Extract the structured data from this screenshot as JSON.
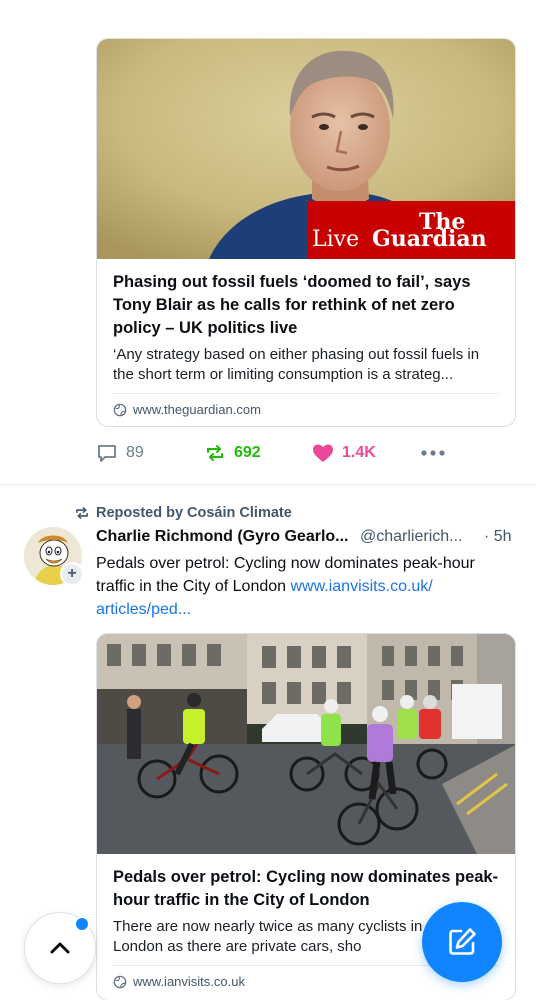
{
  "post1": {
    "card": {
      "image_badge_line1": "The",
      "image_badge_line2": "Live",
      "image_badge_line3": "Guardian",
      "title": "Phasing out fossil fuels ‘doomed to fail’, says Tony Blair as he calls for rethink of net zero policy – UK politics live",
      "description": "‘Any strategy based on either phasing out fossil fuels in the short term or limiting consumption is a strateg...",
      "domain": "www.theguardian.com"
    },
    "actions": {
      "replies": "89",
      "reposts": "692",
      "likes": "1.4K"
    }
  },
  "post2": {
    "repost_label": "Reposted by Cosáin Climate",
    "author_name": "Charlie Richmond (Gyro Gearlo...",
    "author_handle": "@charlierich...",
    "time": "· 5h",
    "text": "Pedals over petrol: Cycling now dominates peak-hour traffic in the City of London ",
    "link": "www.ianvisits.co.uk/ articles/ped...",
    "card": {
      "title": "Pedals over petrol: Cycling now dominates peak-hour traffic in the City of London",
      "description": "There are now nearly twice as many cyclists in the City of London as there are private cars, sho",
      "domain": "www.ianvisits.co.uk"
    }
  },
  "colors": {
    "accent": "#1185fe",
    "repost_green": "#20bc07",
    "like_pink": "#ec4899",
    "muted": "#42576c",
    "guardian_red": "#c70000"
  },
  "icons": {
    "reply": "speech-bubble-icon",
    "repost": "repost-arrows-icon",
    "like": "heart-icon",
    "more": "ellipsis-icon",
    "domain": "globe-icon",
    "scroll_top": "chevron-up-icon",
    "compose": "pencil-square-icon"
  }
}
